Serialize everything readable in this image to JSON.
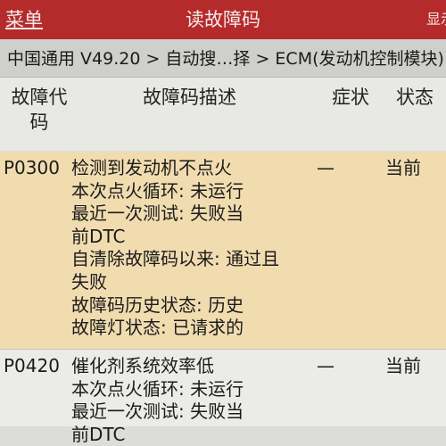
{
  "header": {
    "menu_label": "菜单",
    "title": "读故障码",
    "right_label": "显示"
  },
  "breadcrumb": "中国通用 V49.20 > 自动搜…择 > ECM(发动机控制模块)",
  "columns": {
    "code_line1": "故障代",
    "code_line2": "码",
    "description": "故障码描述",
    "symptom": "症状",
    "status": "状态"
  },
  "rows": [
    {
      "code": "P0300",
      "lines": [
        "检测到发动机不点火",
        "本次点火循环: 未运行",
        "最近一次测试: 失败当",
        "前DTC",
        "自清除故障码以来: 通过且",
        "失败",
        "故障码历史状态: 历史",
        "故障灯状态: 已请求的"
      ],
      "symptom": "—",
      "status": "当前"
    },
    {
      "code": "P0420",
      "lines": [
        "催化剂系统效率低",
        "本次点火循环: 未运行",
        "最近一次测试: 失败当",
        "前DTC"
      ],
      "symptom": "—",
      "status": "当前"
    }
  ]
}
